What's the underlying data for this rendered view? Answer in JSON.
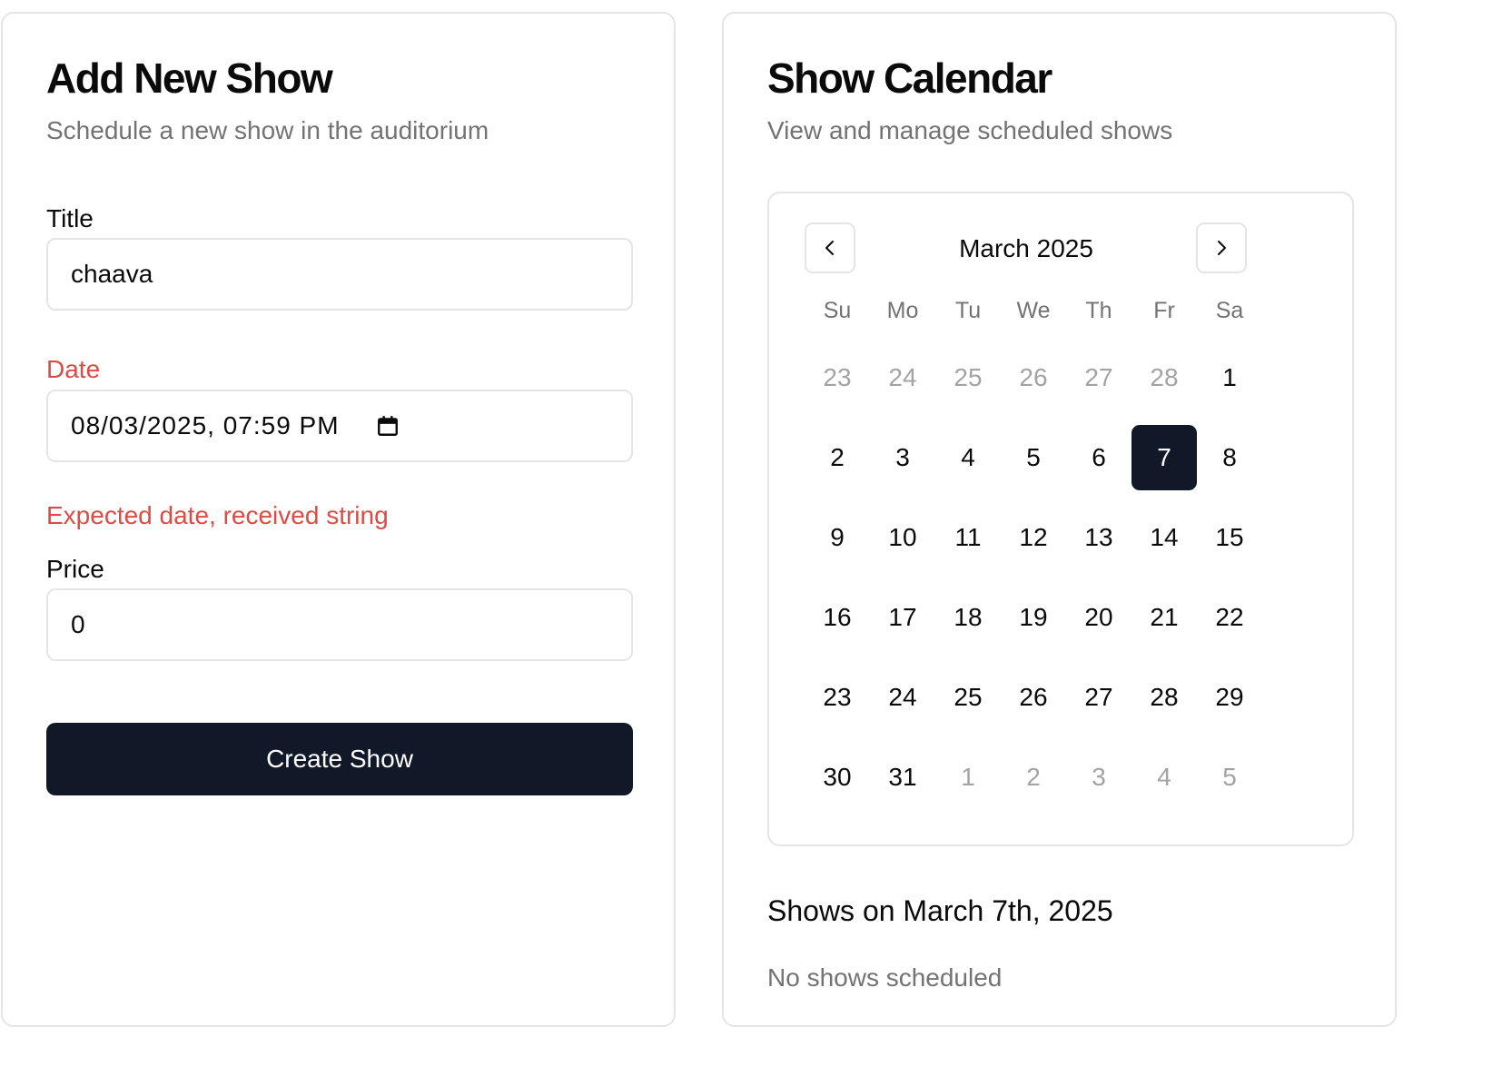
{
  "add_show": {
    "title": "Add New Show",
    "description": "Schedule a new show in the auditorium",
    "fields": {
      "title": {
        "label": "Title",
        "value": "chaava"
      },
      "date": {
        "label": "Date",
        "value": "08/03/2025, 07:59 PM",
        "error": "Expected date, received string"
      },
      "price": {
        "label": "Price",
        "value": "0"
      }
    },
    "submit_label": "Create Show"
  },
  "calendar_card": {
    "title": "Show Calendar",
    "description": "View and manage scheduled shows",
    "month_label": "March 2025",
    "weekdays": [
      "Su",
      "Mo",
      "Tu",
      "We",
      "Th",
      "Fr",
      "Sa"
    ],
    "weeks": [
      [
        "23",
        "24",
        "25",
        "26",
        "27",
        "28",
        "1"
      ],
      [
        "2",
        "3",
        "4",
        "5",
        "6",
        "7",
        "8"
      ],
      [
        "9",
        "10",
        "11",
        "12",
        "13",
        "14",
        "15"
      ],
      [
        "16",
        "17",
        "18",
        "19",
        "20",
        "21",
        "22"
      ],
      [
        "23",
        "24",
        "25",
        "26",
        "27",
        "28",
        "29"
      ],
      [
        "30",
        "31",
        "1",
        "2",
        "3",
        "4",
        "5"
      ]
    ],
    "outside_days": {
      "first_week_count": 6,
      "last_week_count": 5
    },
    "selected_day": "7",
    "shows_heading": "Shows on March 7th, 2025",
    "empty_message": "No shows scheduled"
  },
  "colors": {
    "primary": "#111827",
    "error": "#dc4c44",
    "muted": "#737373",
    "outside_day": "#a3a3a3",
    "border": "#e5e5e5"
  },
  "icons": {
    "prev": "chevron-left-icon",
    "next": "chevron-right-icon",
    "date_picker": "calendar-icon"
  }
}
